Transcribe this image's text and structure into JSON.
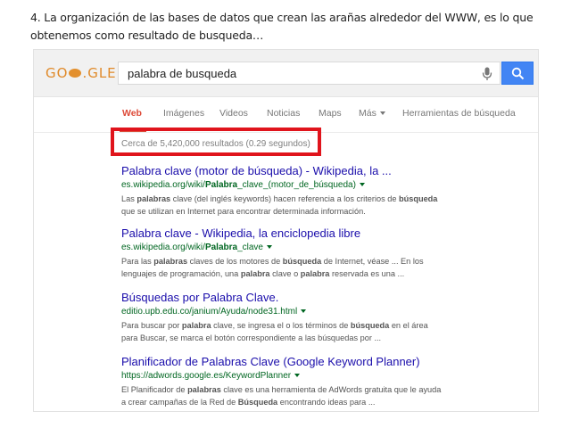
{
  "caption": {
    "line1": "4. La organización de las bases de datos que crean las arañas alrededor del WWW, es lo que",
    "line2": "obtenemos como resultado de busqueda…"
  },
  "logo": {
    "part1": "GO",
    "part2": ".GLE"
  },
  "search": {
    "query": "palabra de busqueda"
  },
  "tabs": [
    {
      "label": "Web"
    },
    {
      "label": "Imágenes"
    },
    {
      "label": "Videos"
    },
    {
      "label": "Noticias"
    },
    {
      "label": "Maps"
    },
    {
      "label": "Más"
    },
    {
      "label": "Herramientas de búsqueda"
    }
  ],
  "stats": "Cerca de 5,420,000 resultados (0.29 segundos)",
  "results": [
    {
      "title": "Palabra clave (motor de búsqueda) - Wikipedia, la ...",
      "url_pre": "es.wikipedia.org/wiki/",
      "url_bold": "Palabra",
      "url_post": "_clave_(motor_de_búsqueda)",
      "s1a": "Las ",
      "s1b": "palabras",
      "s1c": " clave (del inglés keywords) hacen referencia a los criterios de ",
      "s1d": "búsqueda",
      "s2a": "que se utilizan en Internet para encontrar determinada información."
    },
    {
      "title": "Palabra clave - Wikipedia, la enciclopedia libre",
      "url_pre": "es.wikipedia.org/wiki/",
      "url_bold": "Palabra",
      "url_post": "_clave",
      "s1a": "Para las ",
      "s1b": "palabras",
      "s1c": " claves de los motores de ",
      "s1d": "búsqueda",
      "s1e": " de Internet, véase ... En los",
      "s2a": "lenguajes de programación, una ",
      "s2b": "palabra",
      "s2c": " clave o ",
      "s2d": "palabra",
      "s2e": " reservada es una ..."
    },
    {
      "title": "Búsquedas por Palabra Clave.",
      "url": "editio.upb.edu.co/janium/Ayuda/node31.html",
      "s1a": "Para buscar por ",
      "s1b": "palabra",
      "s1c": " clave, se ingresa el o los términos de ",
      "s1d": "búsqueda",
      "s1e": " en el área",
      "s2a": "para Buscar, se marca el botón correspondiente a las búsquedas por ..."
    },
    {
      "title": "Planificador de Palabras Clave (Google Keyword Planner)",
      "url": "https://adwords.google.es/KeywordPlanner",
      "s1a": "El Planificador de ",
      "s1b": "palabras",
      "s1c": " clave es una herramienta de AdWords gratuita que le ayuda",
      "s2a": "a crear campañas de la Red de ",
      "s2b": "Búsqueda",
      "s2c": " encontrando ideas para ..."
    }
  ]
}
